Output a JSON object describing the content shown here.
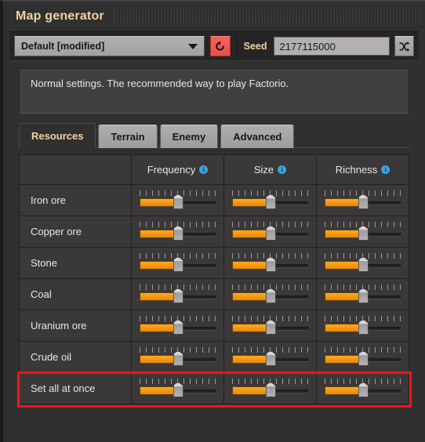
{
  "window": {
    "title": "Map generator"
  },
  "toolbar": {
    "preset": {
      "label": "Default [modified]",
      "icon": "chevron-down-icon"
    },
    "reset": {
      "icon": "reset-arrow-icon",
      "color": "#ec524d"
    },
    "seed": {
      "label": "Seed",
      "value": "2177115000",
      "placeholder": ""
    },
    "shuffle": {
      "icon": "shuffle-icon"
    }
  },
  "description": {
    "text": "Normal settings. The recommended way to play Factorio."
  },
  "tabs": [
    {
      "label": "Resources",
      "active": true
    },
    {
      "label": "Terrain",
      "active": false
    },
    {
      "label": "Enemy",
      "active": false
    },
    {
      "label": "Advanced",
      "active": false
    }
  ],
  "table": {
    "columns": [
      {
        "label": "",
        "info": false
      },
      {
        "label": "Frequency",
        "info": true
      },
      {
        "label": "Size",
        "info": true
      },
      {
        "label": "Richness",
        "info": true
      }
    ],
    "rows": [
      {
        "label": "Iron ore",
        "frequency": 50,
        "size": 50,
        "richness": 50,
        "highlighted": false
      },
      {
        "label": "Copper ore",
        "frequency": 50,
        "size": 50,
        "richness": 50,
        "highlighted": false
      },
      {
        "label": "Stone",
        "frequency": 50,
        "size": 50,
        "richness": 50,
        "highlighted": false
      },
      {
        "label": "Coal",
        "frequency": 50,
        "size": 50,
        "richness": 50,
        "highlighted": false
      },
      {
        "label": "Uranium ore",
        "frequency": 50,
        "size": 50,
        "richness": 50,
        "highlighted": false
      },
      {
        "label": "Crude oil",
        "frequency": 50,
        "size": 50,
        "richness": 50,
        "highlighted": false
      },
      {
        "label": "Set all at once",
        "frequency": 50,
        "size": 50,
        "richness": 50,
        "highlighted": true
      }
    ]
  },
  "colors": {
    "accent_orange": "#f2980f",
    "title_text": "#f0d3a0",
    "panel_bg": "#313031",
    "cell_bg": "#3a3839",
    "highlight_border": "#fb1414",
    "info_blue": "#3ba3dd"
  }
}
